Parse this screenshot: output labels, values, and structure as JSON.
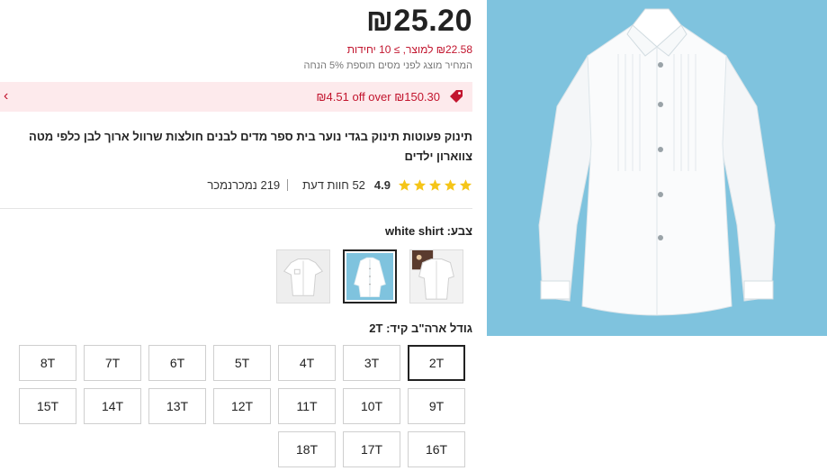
{
  "price": {
    "main": "₪25.20",
    "unit": "₪22.58 למוצר, ≥ 10 יחידות",
    "tax_note": "המחיר מוצג לפני מסים תוספת 5% הנחה"
  },
  "promo": {
    "text": "₪4.51 off over ₪150.30",
    "icon": "tag-icon",
    "chevron": "‹"
  },
  "product": {
    "title": "תינוק פעוטות תינוק בגדי נוער בית ספר מדים לבנים חולצות שרוול ארוך לבן כלפי מטה צווארון ילדים"
  },
  "rating": {
    "value": "4.9",
    "stars": 5,
    "reviews": "52 חוות דעת",
    "sold": "219 נמכרנמכר"
  },
  "color": {
    "label": "צבע:",
    "selected": "white shirt",
    "swatches": [
      "swatch-1",
      "swatch-2",
      "swatch-3"
    ],
    "selected_index": 1
  },
  "size": {
    "label": "גודל ארה\"ב קיד:",
    "selected": "2T",
    "options": [
      "2T",
      "3T",
      "4T",
      "5T",
      "6T",
      "7T",
      "8T",
      "9T",
      "10T",
      "11T",
      "12T",
      "13T",
      "14T",
      "15T",
      "16T",
      "17T",
      "18T"
    ]
  },
  "colors": {
    "accent": "#c2152e",
    "promo_bg": "#fdeaec",
    "star": "#f5c518",
    "image_bg": "#7fc3de"
  }
}
